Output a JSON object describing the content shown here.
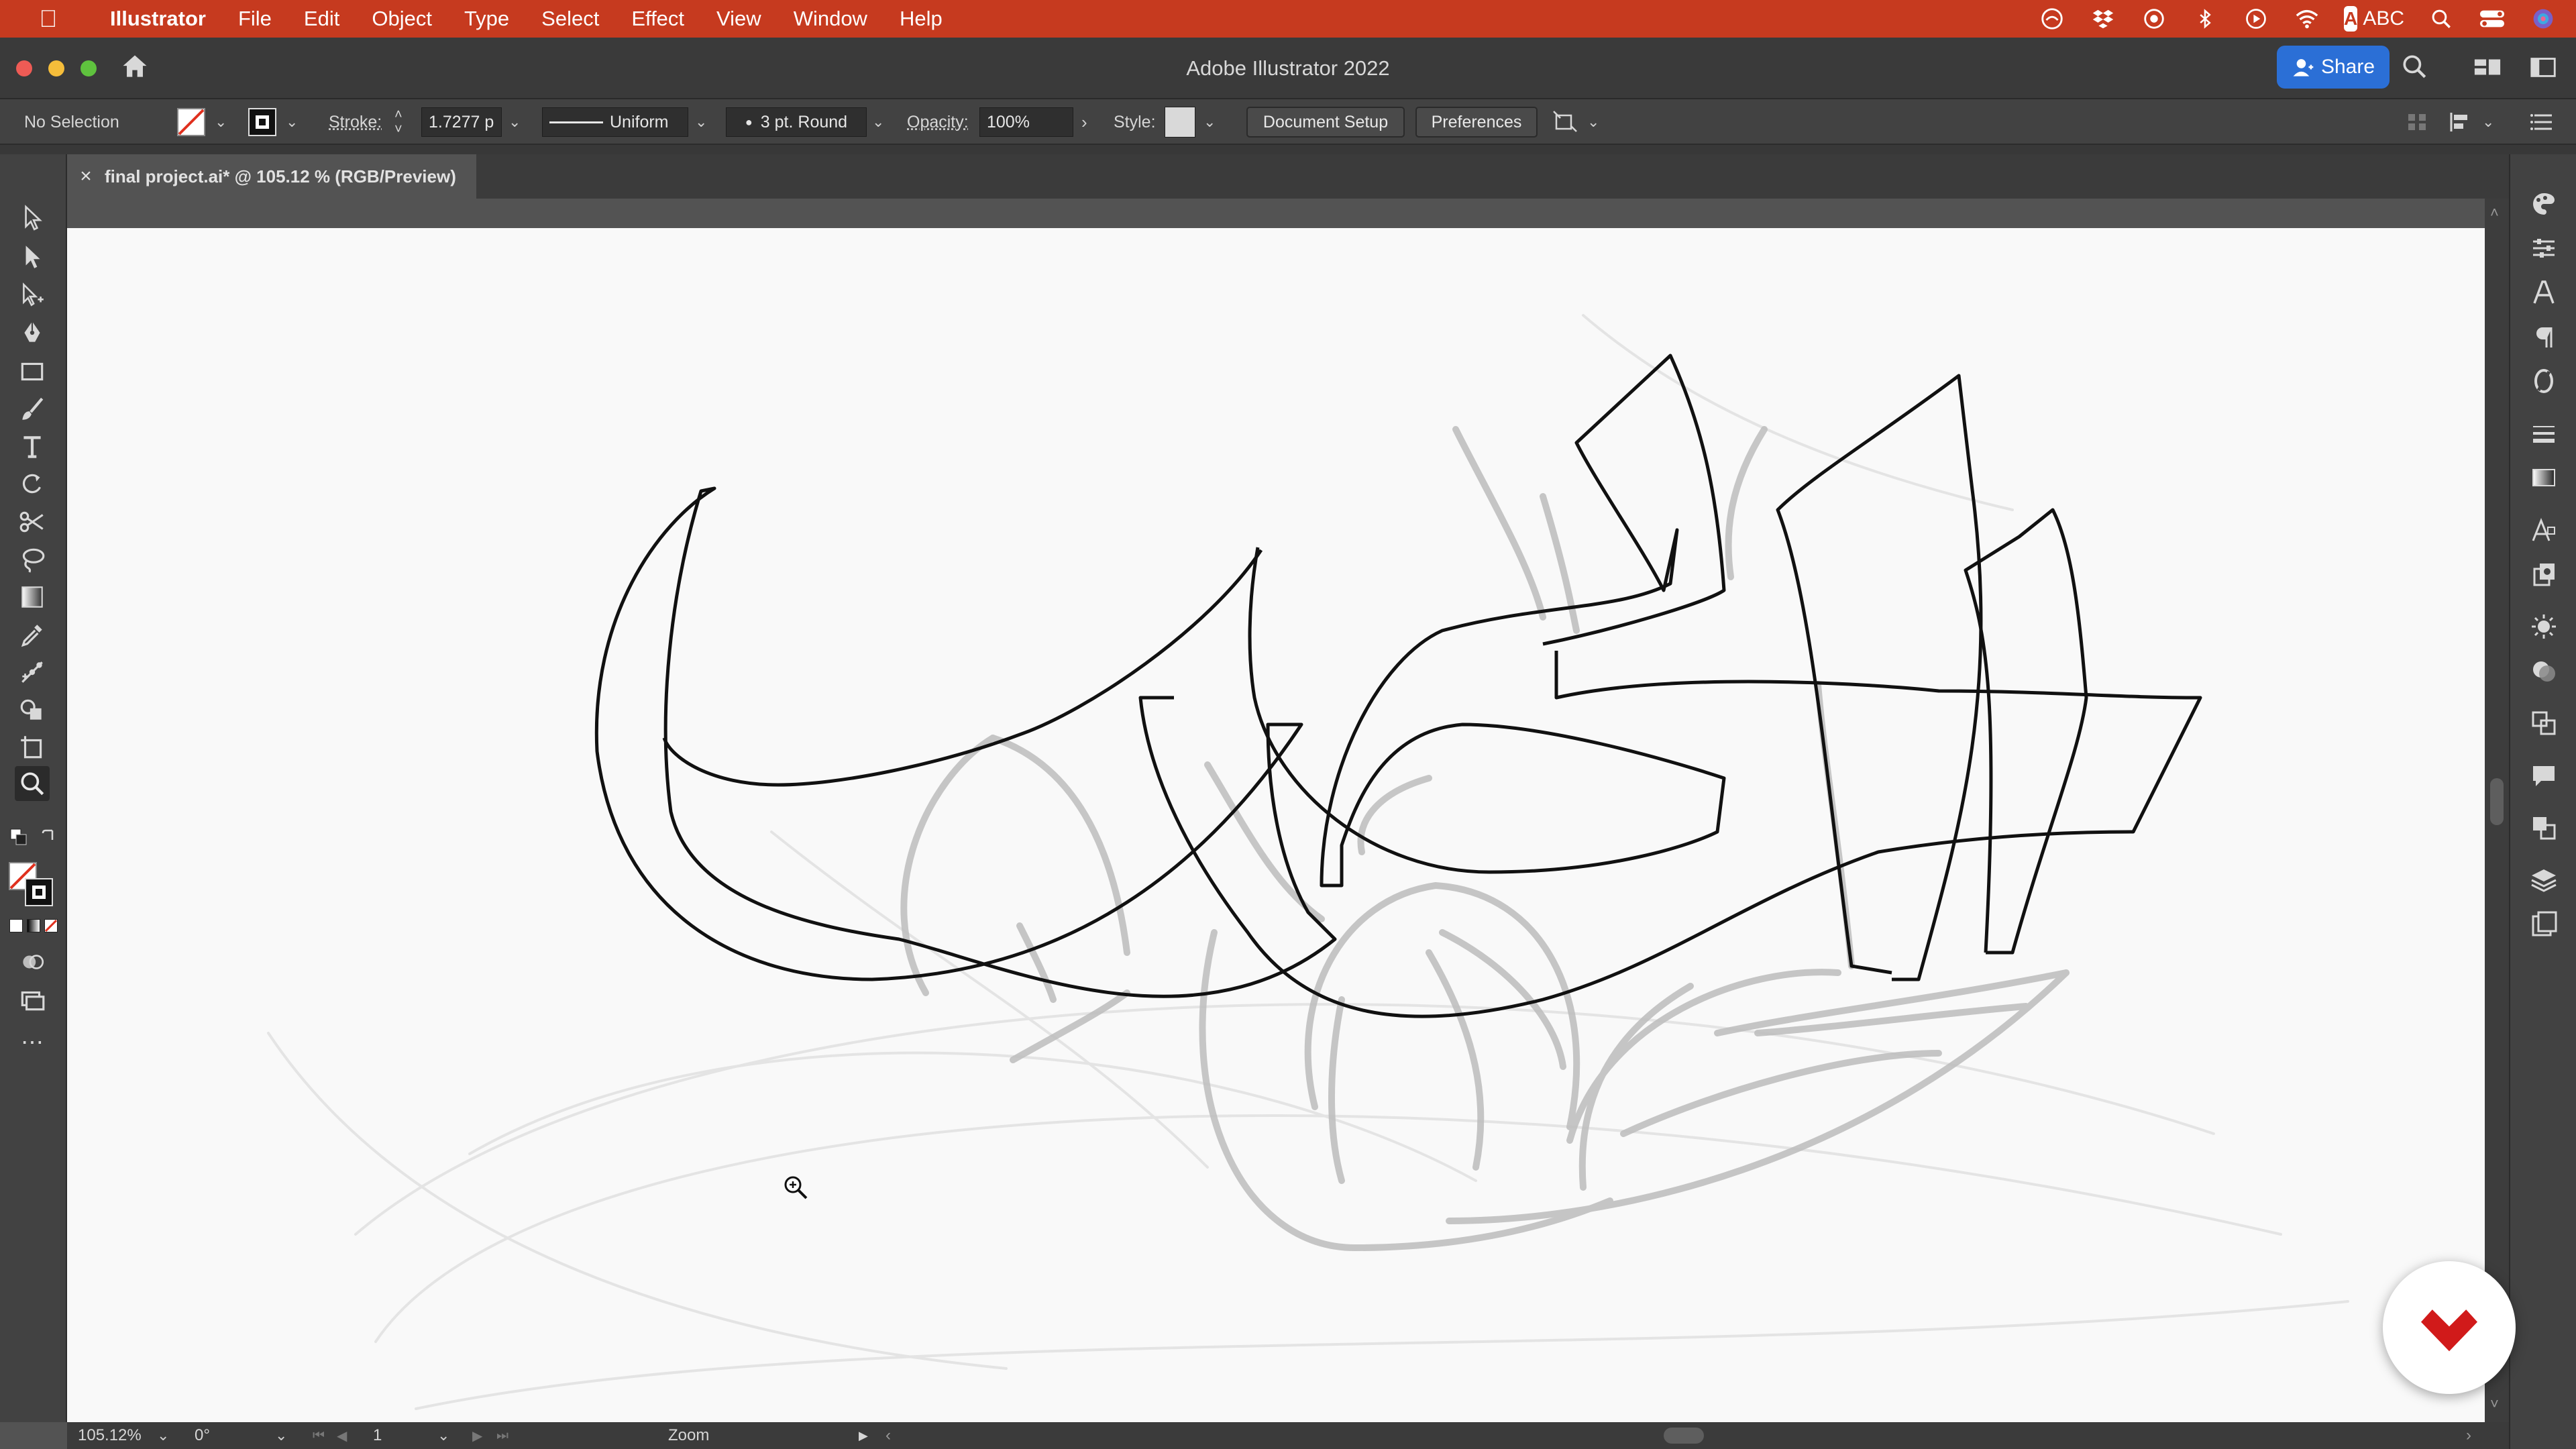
{
  "menubar": {
    "app_name": "Illustrator",
    "items": [
      "File",
      "Edit",
      "Object",
      "Type",
      "Select",
      "Effect",
      "View",
      "Window",
      "Help"
    ],
    "input_source": "ABC"
  },
  "window": {
    "title": "Adobe Illustrator 2022",
    "share_label": "Share"
  },
  "control_bar": {
    "selection_status": "No Selection",
    "stroke_label": "Stroke:",
    "stroke_value": "1.7277 p",
    "stroke_profile": "Uniform",
    "brush": "3 pt. Round",
    "opacity_label": "Opacity:",
    "opacity_value": "100%",
    "style_label": "Style:",
    "document_setup_label": "Document Setup",
    "preferences_label": "Preferences"
  },
  "document_tab": {
    "title": "final project.ai* @ 105.12 % (RGB/Preview)"
  },
  "status_bar": {
    "zoom": "105.12%",
    "rotation": "0°",
    "artboard_number": "1",
    "current_tool": "Zoom"
  },
  "colors": {
    "menubar": "#c63a1f",
    "share_button": "#2b6fd6",
    "artboard": "#f9f9f9",
    "ui_panel": "#424242",
    "logo_red": "#d11a1a"
  },
  "icons": {
    "menubar_right": [
      "creative-cloud-icon",
      "dropbox-icon",
      "sync-icon",
      "bluetooth-icon",
      "play-icon",
      "wifi-icon",
      "input-source-icon",
      "spotlight-icon",
      "control-center-icon",
      "siri-icon"
    ],
    "tools": [
      "selection-tool-icon",
      "direct-selection-tool-icon",
      "group-selection-tool-icon",
      "pen-tool-icon",
      "rectangle-tool-icon",
      "paintbrush-tool-icon",
      "type-tool-icon",
      "rotate-tool-icon",
      "scissors-tool-icon",
      "lasso-tool-icon",
      "gradient-tool-icon",
      "eyedropper-tool-icon",
      "puppet-warp-tool-icon",
      "shape-builder-tool-icon",
      "artboard-tool-icon",
      "zoom-tool-icon"
    ],
    "dock": [
      "color-icon",
      "properties-icon",
      "character-icon",
      "paragraph-icon",
      "opentype-icon",
      "stroke-icon",
      "gradient-icon",
      "glyphs-icon",
      "libraries-icon",
      "appearance-icon",
      "transparency-icon",
      "transform-icon",
      "comments-icon",
      "pathfinder-icon",
      "layers-icon",
      "artboards-icon"
    ]
  }
}
